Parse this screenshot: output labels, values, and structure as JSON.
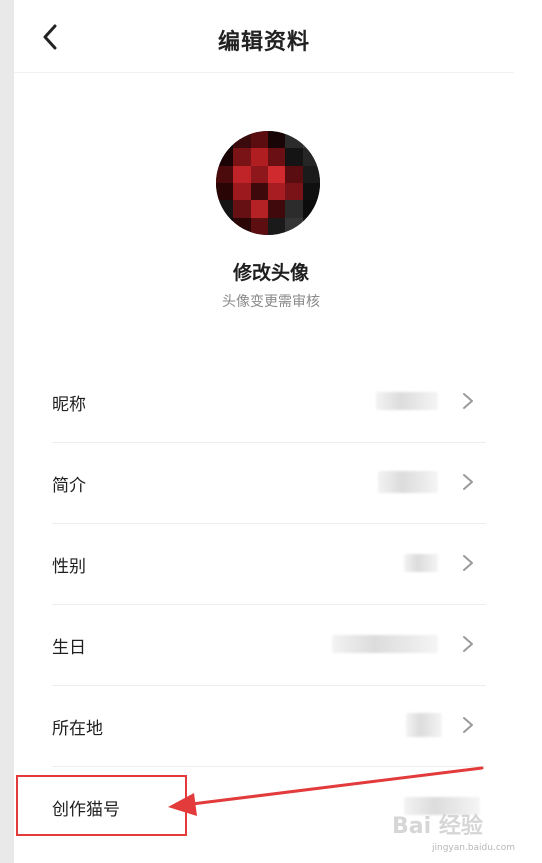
{
  "header": {
    "title": "编辑资料"
  },
  "avatar": {
    "change_label": "修改头像",
    "hint": "头像变更需审核"
  },
  "rows": [
    {
      "label": "昵称"
    },
    {
      "label": "简介"
    },
    {
      "label": "性别"
    },
    {
      "label": "生日"
    },
    {
      "label": "所在地"
    },
    {
      "label": "创作猫号"
    }
  ],
  "watermark": {
    "brand": "Bai 经验",
    "url": "jingyan.baidu.com"
  },
  "colors": {
    "annotation_red": "#e33b3b"
  },
  "icons": {
    "back": "chevron-left-icon",
    "row_arrow": "chevron-right-icon"
  }
}
